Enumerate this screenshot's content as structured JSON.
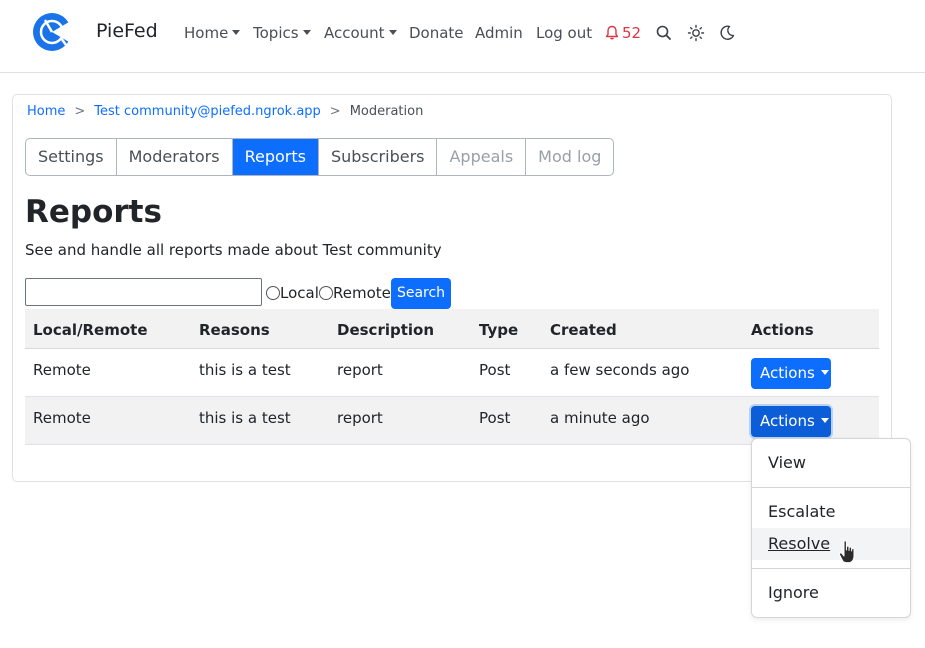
{
  "navbar": {
    "brand": "PieFed",
    "items": [
      {
        "label": "Home",
        "dropdown": true
      },
      {
        "label": "Topics",
        "dropdown": true
      },
      {
        "label": "Account",
        "dropdown": true
      },
      {
        "label": "Donate",
        "dropdown": false
      },
      {
        "label": "Admin",
        "dropdown": false
      },
      {
        "label": "Log out",
        "dropdown": false
      }
    ],
    "notifications_count": "52",
    "icons": [
      "search-icon",
      "sun-icon",
      "moon-icon"
    ]
  },
  "breadcrumb": {
    "items": [
      "Home",
      "Test community@piefed.ngrok.app"
    ],
    "current": "Moderation",
    "separator": ">"
  },
  "tabs": [
    {
      "label": "Settings",
      "state": "normal"
    },
    {
      "label": "Moderators",
      "state": "normal"
    },
    {
      "label": "Reports",
      "state": "active"
    },
    {
      "label": "Subscribers",
      "state": "normal"
    },
    {
      "label": "Appeals",
      "state": "disabled"
    },
    {
      "label": "Mod log",
      "state": "disabled"
    }
  ],
  "page": {
    "title": "Reports",
    "subtitle": "See and handle all reports made about Test community"
  },
  "search": {
    "value": "",
    "radio_local": "Local",
    "radio_remote": "Remote",
    "button": "Search"
  },
  "table": {
    "headers": [
      "Local/Remote",
      "Reasons",
      "Description",
      "Type",
      "Created",
      "Actions"
    ],
    "rows": [
      {
        "local_remote": "Remote",
        "reasons": "this is a test",
        "description": "report",
        "type": "Post",
        "created": "a few seconds ago",
        "actions": "Actions"
      },
      {
        "local_remote": "Remote",
        "reasons": "this is a test",
        "description": "report",
        "type": "Post",
        "created": "a minute ago",
        "actions": "Actions"
      }
    ]
  },
  "dropdown_menu": {
    "items": [
      "View",
      "Escalate",
      "Resolve",
      "Ignore"
    ],
    "hovered": "Resolve"
  },
  "colors": {
    "primary": "#0d6efd",
    "notification": "#dc3545",
    "table_stripe": "#f2f2f2"
  }
}
